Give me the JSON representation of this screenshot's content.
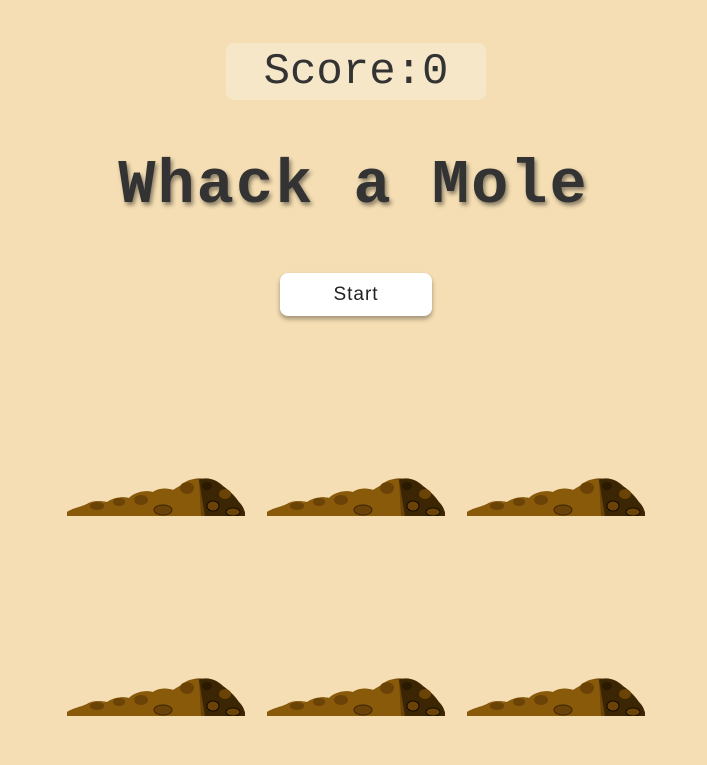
{
  "score": {
    "label": "Score:",
    "value": "0"
  },
  "title": "Whack a Mole",
  "start_button": {
    "label": "Start"
  },
  "board": {
    "rows": 2,
    "columns": 3,
    "holes": [
      {
        "id": "hole-1"
      },
      {
        "id": "hole-2"
      },
      {
        "id": "hole-3"
      },
      {
        "id": "hole-4"
      },
      {
        "id": "hole-5"
      },
      {
        "id": "hole-6"
      }
    ]
  },
  "colors": {
    "background": "#f5deb3",
    "score_box": "#f6e7c8",
    "text": "#333333",
    "dirt_light": "#8a5a0b",
    "dirt_mid": "#6b4306",
    "dirt_dark": "#3b2503"
  },
  "icons": {
    "hole": "dirt-mound-icon"
  }
}
